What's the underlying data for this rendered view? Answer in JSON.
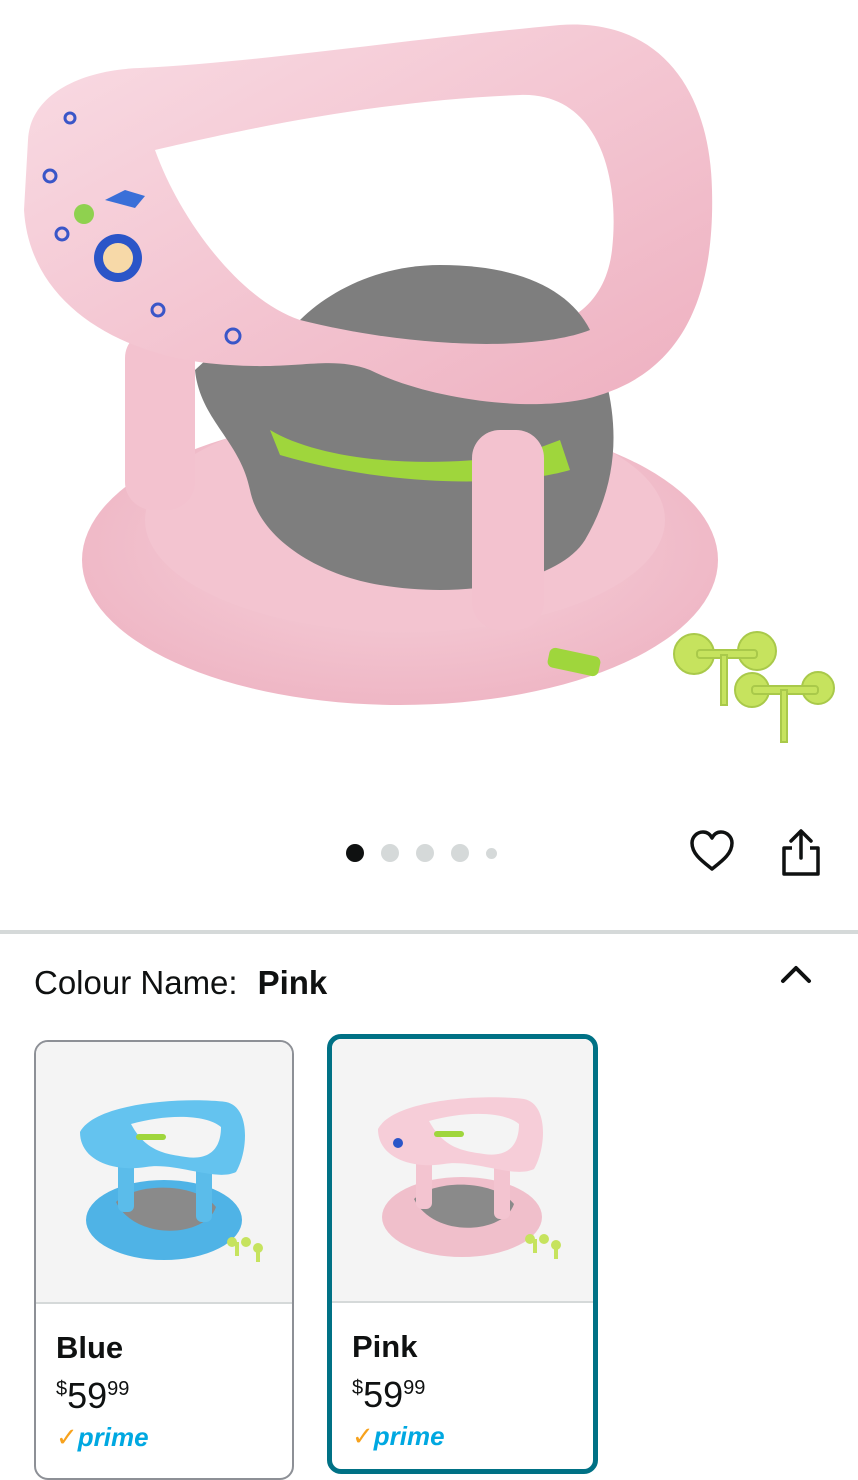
{
  "gallery": {
    "image_alt": "Pink baby bath seat",
    "dot_count": 5,
    "active_dot": 0
  },
  "actions": {
    "wishlist_icon": "heart-icon",
    "share_icon": "share-icon"
  },
  "variation": {
    "label": "Colour Name:",
    "selected": "Pink",
    "collapse_icon": "chevron-up-icon"
  },
  "swatches": [
    {
      "name": "Blue",
      "currency": "$",
      "whole": "59",
      "fraction": "99",
      "prime": "prime",
      "color": "#5bbcea",
      "selected": false
    },
    {
      "name": "Pink",
      "currency": "$",
      "whole": "59",
      "fraction": "99",
      "prime": "prime",
      "color": "#f2bfcc",
      "selected": true
    }
  ],
  "colors": {
    "accent_selected": "#007185",
    "seat_pink": "#f4c6d2",
    "seat_green": "#9fd63c",
    "mat_gray": "#7d7d7d"
  }
}
